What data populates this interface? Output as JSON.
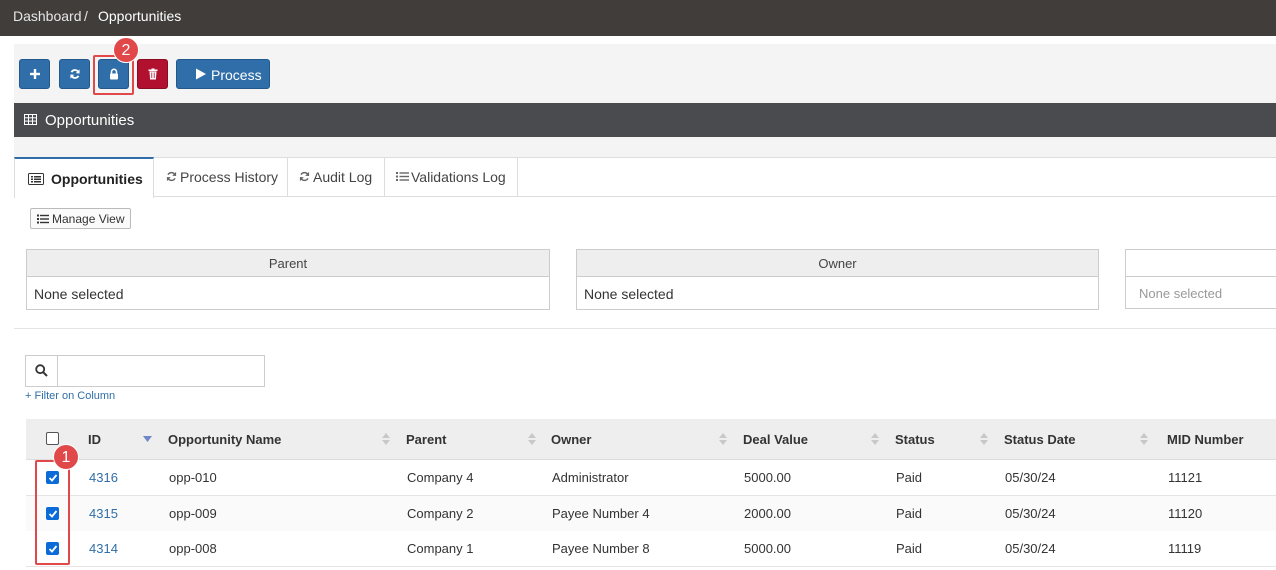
{
  "breadcrumb": {
    "home": "Dashboard",
    "separator": "/",
    "current": "Opportunities"
  },
  "toolbar": {
    "process_label": "Process"
  },
  "annotations": {
    "badge_1": "1",
    "badge_2": "2"
  },
  "panel": {
    "title": "Opportunities"
  },
  "tabs": [
    {
      "label": "Opportunities"
    },
    {
      "label": "Process History"
    },
    {
      "label": "Audit Log"
    },
    {
      "label": "Validations Log"
    }
  ],
  "manage_view_label": "Manage View",
  "filters": {
    "parent": {
      "header": "Parent",
      "value": "None selected"
    },
    "owner": {
      "header": "Owner",
      "value": "None selected"
    },
    "third": {
      "header": "",
      "value": "None selected"
    }
  },
  "search": {
    "placeholder": "",
    "filter_link": "+ Filter on Column"
  },
  "table": {
    "columns": [
      "ID",
      "Opportunity Name",
      "Parent",
      "Owner",
      "Deal Value",
      "Status",
      "Status Date",
      "MID Number"
    ],
    "rows": [
      {
        "id": "4316",
        "name": "opp-010",
        "parent": "Company 4",
        "owner": "Administrator",
        "deal_value": "5000.00",
        "status": "Paid",
        "status_date": "05/30/24",
        "mid": "11121",
        "checked": true
      },
      {
        "id": "4315",
        "name": "opp-009",
        "parent": "Company 2",
        "owner": "Payee Number 4",
        "deal_value": "2000.00",
        "status": "Paid",
        "status_date": "05/30/24",
        "mid": "11120",
        "checked": true
      },
      {
        "id": "4314",
        "name": "opp-008",
        "parent": "Company 1",
        "owner": "Payee Number 8",
        "deal_value": "5000.00",
        "status": "Paid",
        "status_date": "05/30/24",
        "mid": "11119",
        "checked": true
      }
    ]
  },
  "colors": {
    "primary": "#2f6ea8",
    "danger": "#b1102e",
    "topbar": "#403d3b",
    "panel_header": "#4a4b4e",
    "marker": "#e0484a",
    "checkbox": "#0b6cd8"
  }
}
